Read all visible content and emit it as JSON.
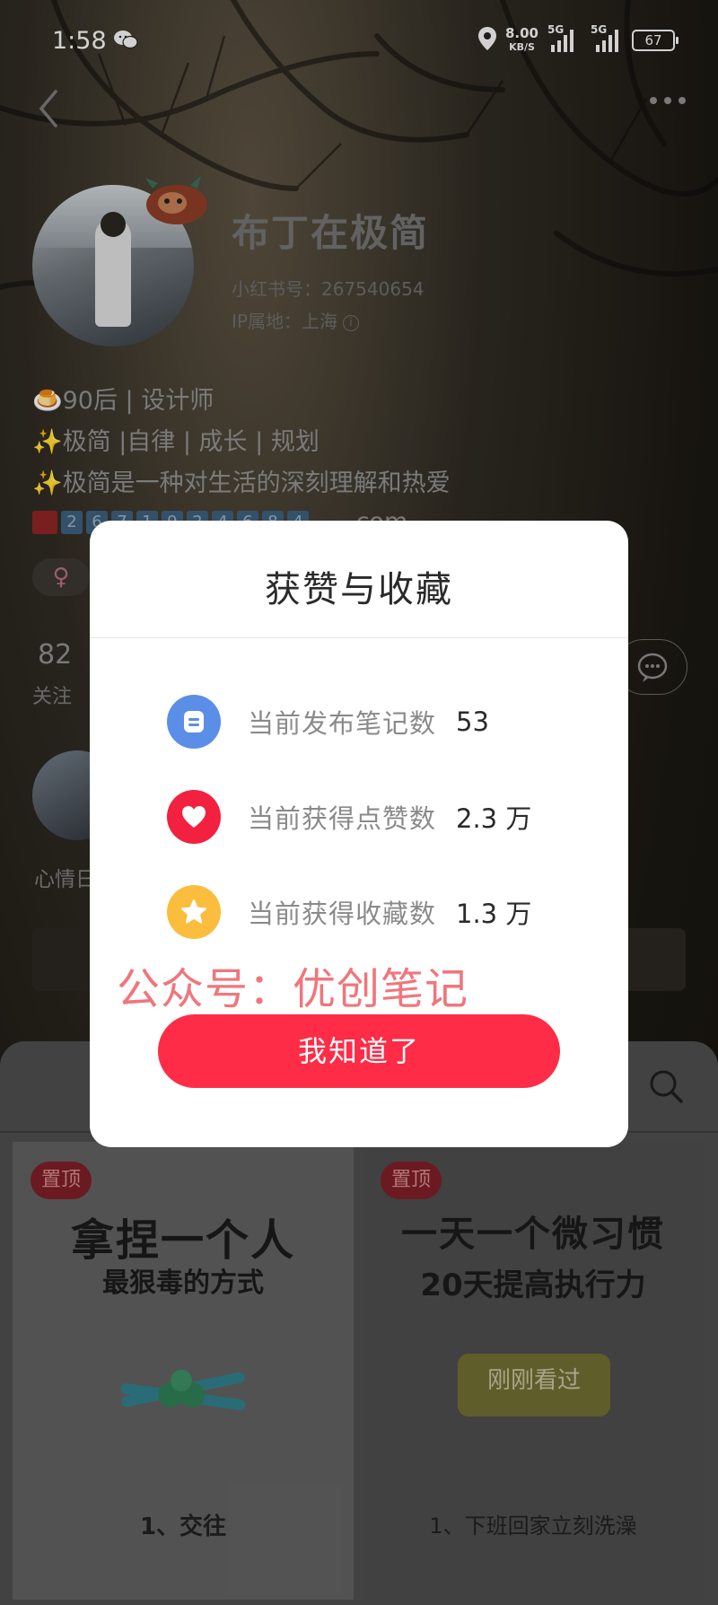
{
  "status_bar": {
    "time": "1:58",
    "net_speed_value": "8.00",
    "net_speed_unit": "KB/S",
    "signal_1": "5G",
    "signal_2": "5G",
    "battery": "67"
  },
  "profile": {
    "name": "布丁在极简",
    "id_line": "小红书号：267540654",
    "ip_line": "IP属地：上海",
    "bio": [
      "🍮90后 | 设计师",
      "✨极简 |自律 | 成长 | 规划",
      "✨极简是一种对生活的深刻理解和热爱"
    ],
    "email_suffix": ".com",
    "gender_symbol": "♀",
    "follow_count": "82",
    "follow_label": "关注",
    "story_label": "心情日"
  },
  "notes": [
    {
      "badge": "置顶",
      "title_1": "拿捏一个人",
      "title_2": "最狠毒的方式",
      "footer": "1、交往"
    },
    {
      "badge": "置顶",
      "title_1": "一天一个微习惯",
      "title_2": "20天提高执行力",
      "seen_label": "刚刚看过",
      "footer": "1、下班回家立刻洗澡"
    }
  ],
  "dialog": {
    "title": "获赞与收藏",
    "stats": [
      {
        "icon": "note-icon",
        "color": "#5b8ee6",
        "label": "当前发布笔记数",
        "value": "53"
      },
      {
        "icon": "heart-icon",
        "color": "#f2213f",
        "label": "当前获得点赞数",
        "value": "2.3 万"
      },
      {
        "icon": "star-icon",
        "color": "#fbbd3e",
        "label": "当前获得收藏数",
        "value": "1.3 万"
      }
    ],
    "confirm_label": "我知道了",
    "accent_color": "#fe2c47"
  },
  "watermark": "公众号：优创笔记"
}
